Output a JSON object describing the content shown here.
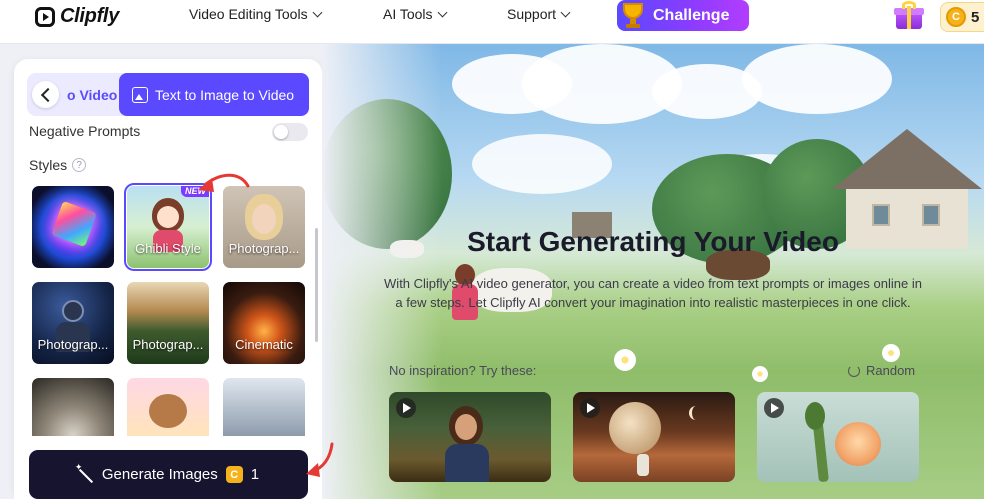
{
  "header": {
    "brand": "Clipfly",
    "nav": [
      {
        "label": "Video Editing Tools"
      },
      {
        "label": "AI Tools"
      },
      {
        "label": "Support"
      }
    ],
    "challenge_label": "Challenge",
    "credits": {
      "coin": "C",
      "count": "5"
    }
  },
  "panel": {
    "tab_partial": "o Video",
    "tab_active": "Text to Image to Video",
    "negative_prompts_label": "Negative Prompts",
    "styles_label": "Styles",
    "help": "?",
    "styles": [
      {
        "label": "",
        "selected": false
      },
      {
        "label": "Ghibli Style",
        "selected": true,
        "badge": "NEW"
      },
      {
        "label": "Photograp..."
      },
      {
        "label": "Photograp..."
      },
      {
        "label": "Photograp..."
      },
      {
        "label": "Cinematic"
      },
      {
        "label": ""
      },
      {
        "label": ""
      },
      {
        "label": ""
      }
    ],
    "generate": {
      "label": "Generate Images",
      "cost_icon": "C",
      "cost": "1"
    }
  },
  "hero": {
    "title": "Start Generating Your Video",
    "description": "With Clipfly's AI video generator, you can create a video from text prompts or images online in a few steps. Let Clipfly AI convert your imagination into realistic masterpieces in one click.",
    "inspiration_label": "No inspiration? Try these:",
    "random_label": "Random"
  },
  "colors": {
    "accent": "#5b49ff",
    "generate_bg": "#16142e",
    "annotation": "#e53935"
  }
}
